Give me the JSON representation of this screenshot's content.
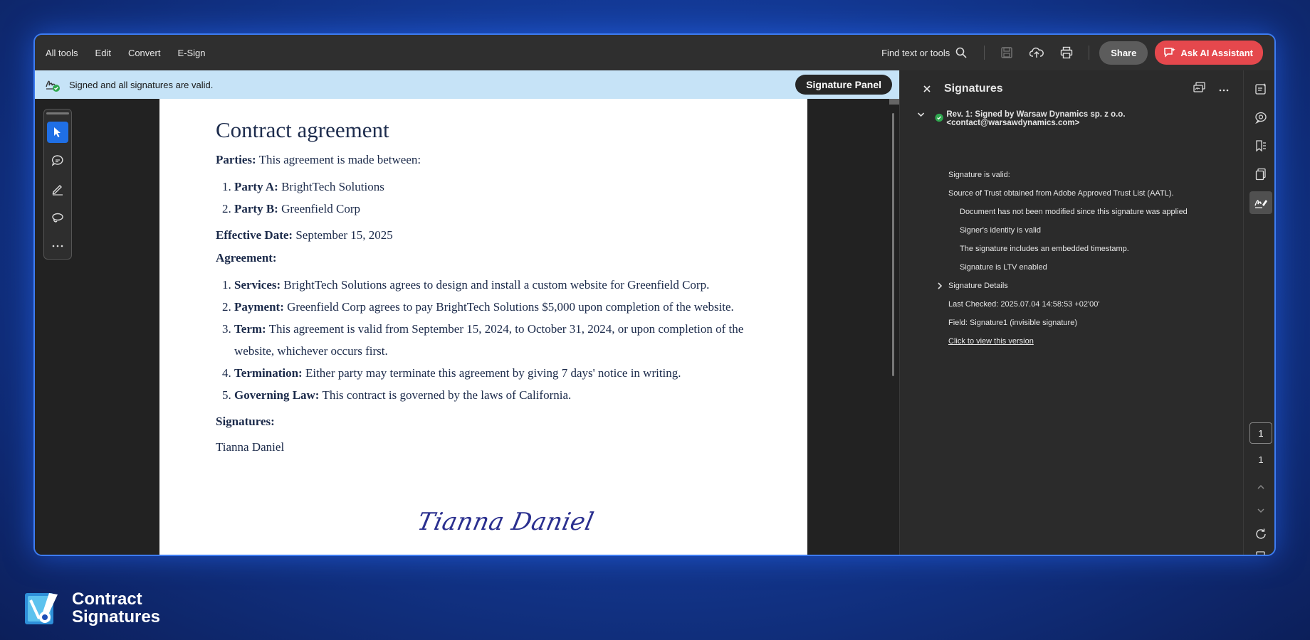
{
  "toolbar": {
    "menu": [
      "All tools",
      "Edit",
      "Convert",
      "E-Sign"
    ],
    "find_label": "Find text or tools",
    "share_label": "Share",
    "ai_label": "Ask AI Assistant"
  },
  "signature_bar": {
    "status": "Signed and all signatures are valid.",
    "panel_button": "Signature Panel"
  },
  "document": {
    "title": "Contract agreement",
    "parties_label": "Parties:",
    "parties_text": "This agreement is made between:",
    "parties": [
      {
        "label": "Party A:",
        "text": "BrightTech Solutions"
      },
      {
        "label": "Party B:",
        "text": "Greenfield Corp"
      }
    ],
    "effective_label": "Effective Date:",
    "effective_text": "September 15, 2025",
    "agreement_label": "Agreement:",
    "clauses": [
      {
        "label": "Services:",
        "text": "BrightTech Solutions agrees to design and install a custom website for Greenfield Corp."
      },
      {
        "label": "Payment:",
        "text": "Greenfield Corp agrees to pay BrightTech Solutions $5,000 upon completion of the website."
      },
      {
        "label": "Term:",
        "text": "This agreement is valid from September 15, 2024, to October 31, 2024, or upon completion of the website, whichever occurs first."
      },
      {
        "label": "Termination:",
        "text": "Either party may terminate this agreement by giving 7 days' notice in writing."
      },
      {
        "label": "Governing Law:",
        "text": "This contract is governed by the laws of California."
      }
    ],
    "signatures_label": "Signatures:",
    "signer_name": "Tianna Daniel",
    "handwritten_signature": "Tianna Daniel"
  },
  "signature_panel": {
    "title": "Signatures",
    "revision": "Rev. 1: Signed by Warsaw Dynamics sp. z o.o. <contact@warsawdynamics.com>",
    "valid": "Signature is valid:",
    "trust_source": "Source of Trust obtained from Adobe Approved Trust List (AATL).",
    "checks": [
      "Document has not been modified since this signature was applied",
      "Signer's identity is valid",
      "The signature includes an embedded timestamp.",
      "Signature is LTV enabled"
    ],
    "details_label": "Signature Details",
    "last_checked": "Last Checked: 2025.07.04 14:58:53 +02'00'",
    "field": "Field: Signature1 (invisible signature)",
    "view_link": "Click to view this version"
  },
  "rail": {
    "page_current": "1",
    "page_total": "1"
  },
  "brand": {
    "line1": "Contract",
    "line2": "Signatures"
  },
  "colors": {
    "accent": "#1f6fe5",
    "ai_button": "#e5484d",
    "sigbar": "#c6e3f7",
    "valid_green": "#2fa84f"
  }
}
